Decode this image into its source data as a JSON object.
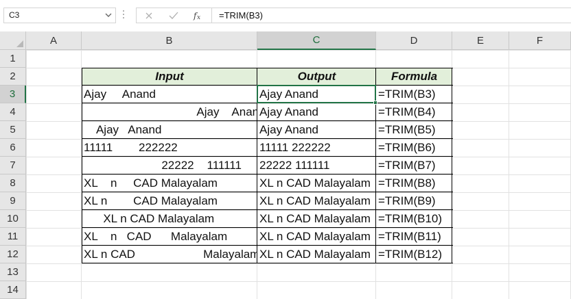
{
  "name_box": {
    "value": "C3"
  },
  "formula_bar": {
    "cancel_icon": "x-icon",
    "enter_icon": "check-icon",
    "fx_icon": "fx-icon",
    "value": "=TRIM(B3)"
  },
  "columns": [
    "A",
    "B",
    "C",
    "D",
    "E",
    "F"
  ],
  "rows": [
    "1",
    "2",
    "3",
    "4",
    "5",
    "6",
    "7",
    "8",
    "9",
    "10",
    "11",
    "12",
    "13",
    "14"
  ],
  "selected": {
    "column": "C",
    "row": "3"
  },
  "colors": {
    "header_fill": "#e2efda",
    "selection": "#217346"
  },
  "table": {
    "headers": [
      "Input",
      "Output",
      "Formula"
    ],
    "rows": [
      {
        "input": "Ajay     Anand",
        "output": "Ajay Anand",
        "formula": "=TRIM(B3)"
      },
      {
        "input": "                                   Ajay    Anand",
        "output": "Ajay Anand",
        "formula": "=TRIM(B4)"
      },
      {
        "input": "    Ajay   Anand",
        "output": "Ajay Anand",
        "formula": "=TRIM(B5)"
      },
      {
        "input": "11111        222222",
        "output": "11111 222222",
        "formula": "=TRIM(B6)"
      },
      {
        "input": "                        22222    111111",
        "output": "22222 111111",
        "formula": "=TRIM(B7)"
      },
      {
        "input": "XL    n     CAD Malayalam",
        "output": "XL n CAD Malayalam",
        "formula": "=TRIM(B8)"
      },
      {
        "input": "XL n        CAD Malayalam",
        "output": "XL n CAD Malayalam",
        "formula": "=TRIM(B9)"
      },
      {
        "input": "      XL n CAD Malayalam",
        "output": "XL n CAD Malayalam",
        "formula": "=TRIM(B10)"
      },
      {
        "input": "XL    n   CAD      Malayalam",
        "output": "XL n CAD Malayalam",
        "formula": "=TRIM(B11)"
      },
      {
        "input": "XL n CAD                     Malayalam",
        "output": "XL n CAD Malayalam",
        "formula": "=TRIM(B12)"
      }
    ]
  }
}
